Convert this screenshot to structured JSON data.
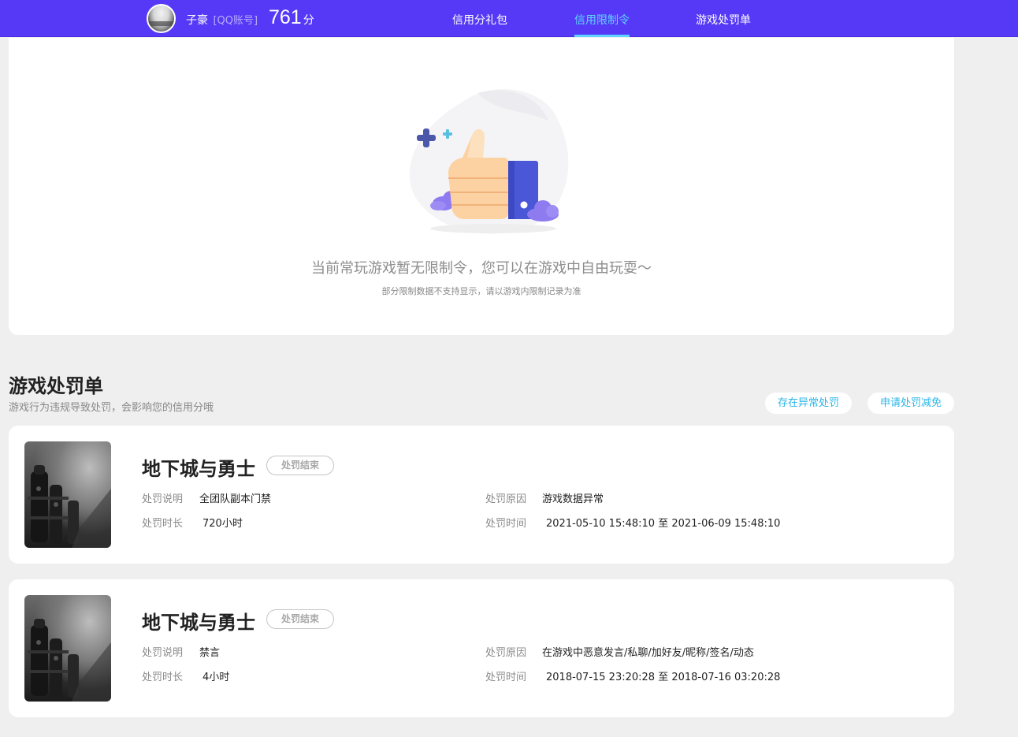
{
  "header": {
    "username": "子豪",
    "account_type": "[QQ账号]",
    "score": "761",
    "score_unit": "分",
    "tabs": [
      {
        "label": "信用分礼包",
        "active": false
      },
      {
        "label": "信用限制令",
        "active": true
      },
      {
        "label": "游戏处罚单",
        "active": false
      }
    ],
    "colors": {
      "bar": "#5539f6",
      "active_tab": "#5fd6ff"
    }
  },
  "restriction": {
    "empty_title": "当前常玩游戏暂无限制令，您可以在游戏中自由玩耍～",
    "empty_subtitle": "部分限制数据不支持显示，请以游戏内限制记录为准",
    "illustration_icon": "thumbs-up-icon"
  },
  "penalties": {
    "title": "游戏处罚单",
    "subtitle": "游戏行为违规导致处罚，会影响您的信用分哦",
    "buttons": {
      "report_abnormal": "存在异常处罚",
      "apply_reduction": "申请处罚减免"
    },
    "labels": {
      "description": "处罚说明",
      "duration": "处罚时长",
      "reason": "处罚原因",
      "time": "处罚时间"
    },
    "items": [
      {
        "game": "地下城与勇士",
        "status": "处罚结束",
        "description": "全团队副本门禁",
        "duration": "720小时",
        "reason": "游戏数据异常",
        "time": "2021-05-10 15:48:10 至 2021-06-09 15:48:10"
      },
      {
        "game": "地下城与勇士",
        "status": "处罚结束",
        "description": "禁言",
        "duration": "4小时",
        "reason": "在游戏中恶意发言/私聊/加好友/昵称/签名/动态",
        "time": "2018-07-15 23:20:28 至 2018-07-16 03:20:28"
      }
    ]
  }
}
